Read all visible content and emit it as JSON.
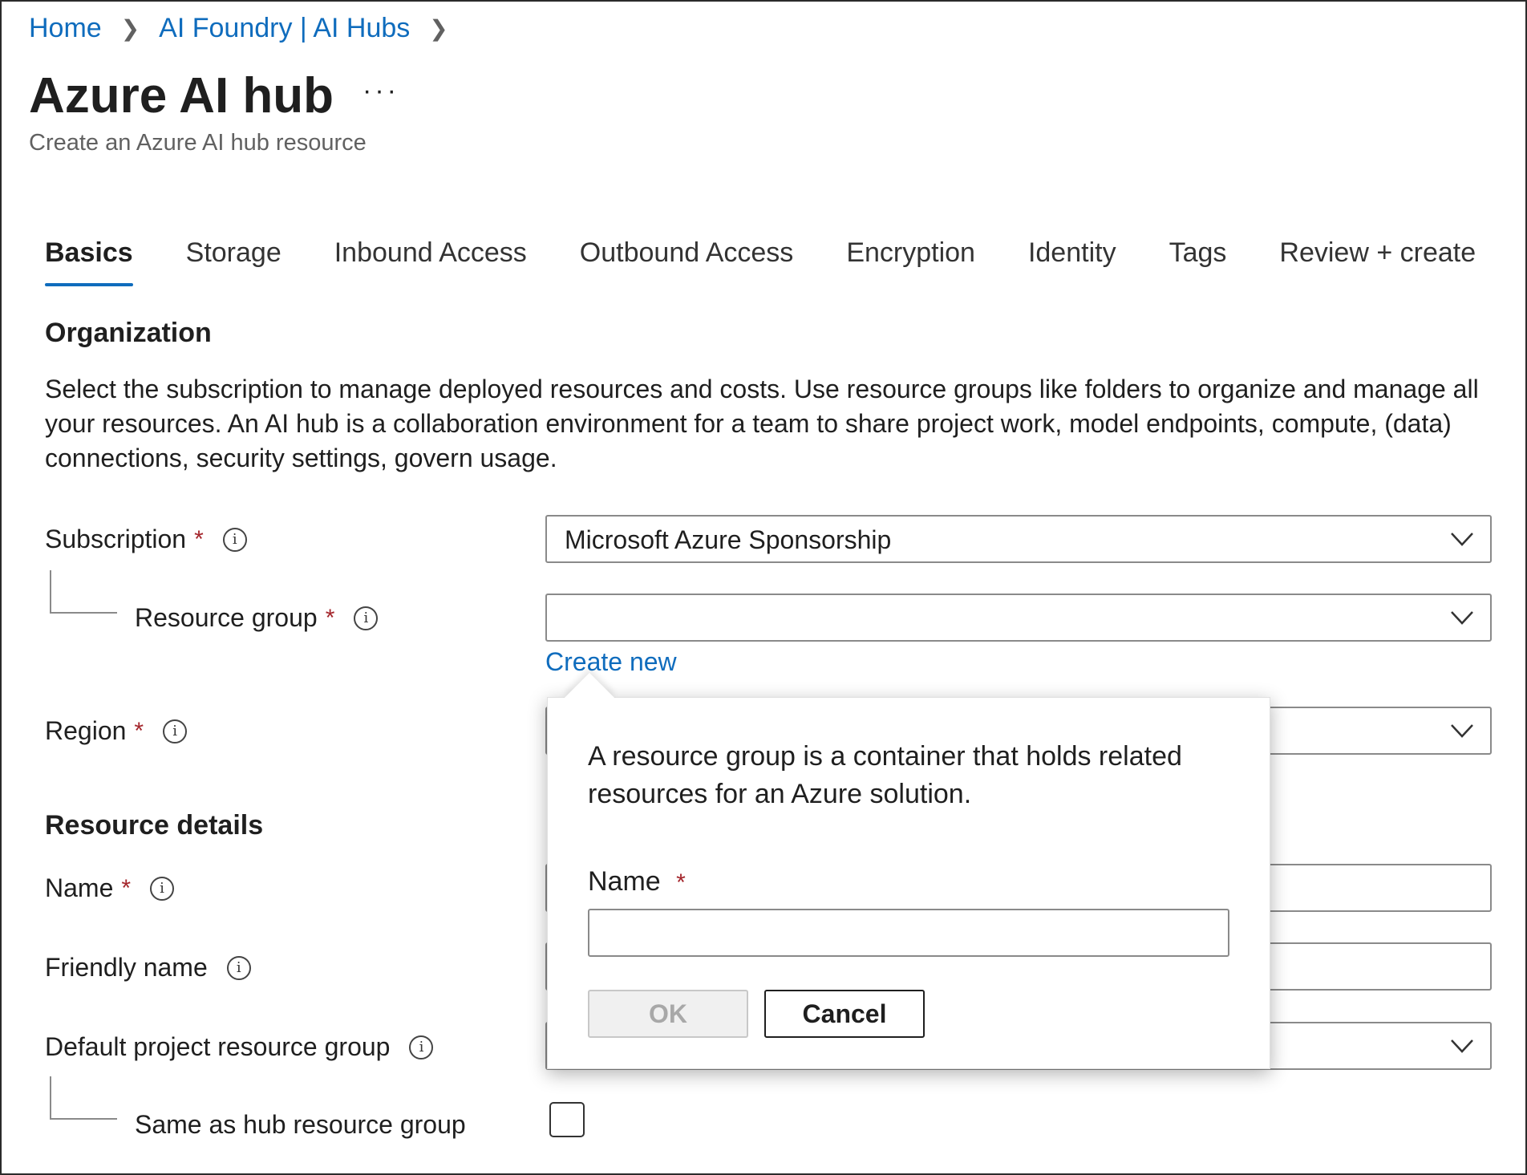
{
  "breadcrumb": {
    "items": [
      "Home",
      "AI Foundry | AI Hubs"
    ]
  },
  "header": {
    "title": "Azure AI hub",
    "more": "···",
    "subtitle": "Create an Azure AI hub resource"
  },
  "tabs": [
    "Basics",
    "Storage",
    "Inbound Access",
    "Outbound Access",
    "Encryption",
    "Identity",
    "Tags",
    "Review + create"
  ],
  "active_tab": "Basics",
  "organization": {
    "title": "Organization",
    "description": "Select the subscription to manage deployed resources and costs. Use resource groups like folders to organize and manage all your resources. An AI hub is a collaboration environment for a team to share project work, model endpoints, compute, (data) connections, security settings, govern usage.",
    "subscription_label": "Subscription",
    "subscription_value": "Microsoft Azure Sponsorship",
    "resource_group_label": "Resource group",
    "resource_group_value": "",
    "create_new": "Create new",
    "region_label": "Region",
    "required_mark": "*",
    "info_glyph": "i"
  },
  "resource_details": {
    "title": "Resource details",
    "name_label": "Name",
    "friendly_name_label": "Friendly name",
    "default_project_rg_label": "Default project resource group",
    "same_as_hub_label": "Same as hub resource group",
    "same_as_hub_checked": false
  },
  "popup": {
    "description": "A resource group is a container that holds related resources for an Azure solution.",
    "name_label": "Name",
    "name_value": "",
    "ok_label": "OK",
    "cancel_label": "Cancel"
  },
  "colors": {
    "link": "#0f6cbd",
    "required": "#a4262c",
    "tab_underline": "#0f6cbd"
  }
}
